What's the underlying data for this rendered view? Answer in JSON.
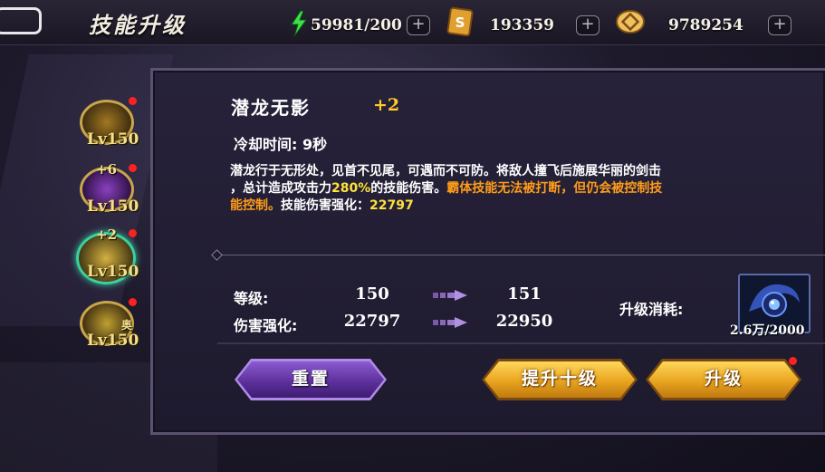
{
  "header": {
    "title": "技能升级",
    "energy": "59981/200",
    "gold_tickets": "193359",
    "coins": "9789254",
    "plus": "+"
  },
  "skill_tabs": [
    {
      "level": "Lv150",
      "plus": ""
    },
    {
      "level": "Lv150",
      "plus": "+6"
    },
    {
      "level": "Lv150",
      "plus": "+2"
    },
    {
      "level": "Lv150",
      "plus": "",
      "tag": "奥"
    }
  ],
  "skill": {
    "name": "潜龙无影",
    "plus": "+2",
    "cooldown": "冷却时间: 9秒",
    "desc_line1": "潜龙行于无形处，见首不见尾，可遇而不可防。将敌人撞飞后施展华丽的剑击",
    "desc_line2_a": "，总计造成攻击力",
    "desc_line2_pct": "280%",
    "desc_line2_b": "的技能伤害。",
    "desc_line2_orange": "霸体技能无法被打断，但仍会被控制技",
    "desc_line3_orange": "能控制。",
    "desc_line3_b": "技能伤害强化：",
    "desc_line3_val": "22797"
  },
  "stats": {
    "level_label": "等级:",
    "level_from": "150",
    "level_to": "151",
    "dmg_label": "伤害强化:",
    "dmg_from": "22797",
    "dmg_to": "22950"
  },
  "cost": {
    "label": "升级消耗:",
    "count": "2.6万/2000"
  },
  "buttons": {
    "reset": "重置",
    "upgrade_ten": "提升十级",
    "upgrade": "升级"
  },
  "colors": {
    "accent_gold": "#ffcc22",
    "highlight_orange": "#ff9c1a",
    "highlight_yellow": "#ffe23a",
    "panel_bg": "#221e33"
  }
}
